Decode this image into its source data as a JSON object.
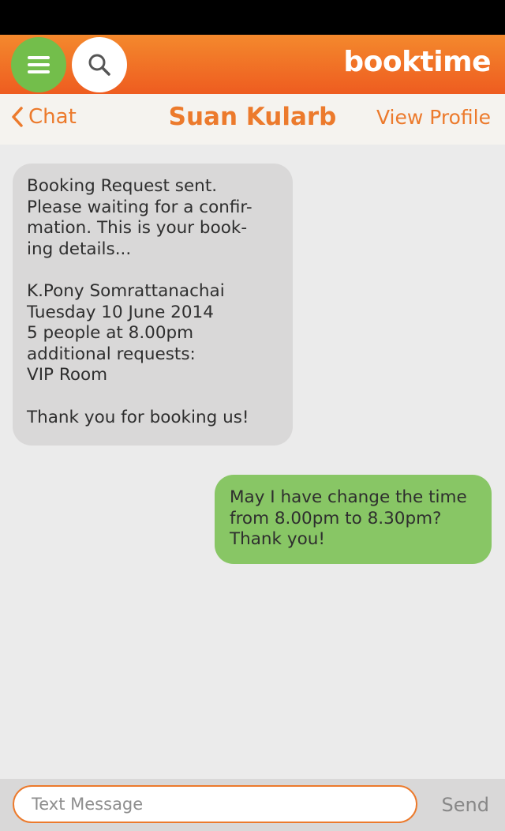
{
  "header": {
    "logo_text": "booktime",
    "menu_icon": "hamburger-menu-icon",
    "search_icon": "search-icon",
    "colors": {
      "bar_top": "#f4892d",
      "bar_bottom": "#ee5c20",
      "menu_button": "#73be4b",
      "accent": "#ec7a2c"
    }
  },
  "nav": {
    "back_label": "Chat",
    "contact_name": "Suan Kularb",
    "view_profile_label": "View Profile"
  },
  "messages": [
    {
      "direction": "received",
      "text": "Booking Request sent.\nPlease waiting for a confir-\nmation. This is your book-\ning details...\n\nK.Pony Somrattanachai\nTuesday 10 June 2014\n5 people at 8.00pm\nadditional requests:\nVIP Room\n\nThank you for booking us!",
      "color": "#d9d8d8"
    },
    {
      "direction": "sent",
      "text": "May I have change the time\nfrom 8.00pm to 8.30pm?\nThank you!",
      "color": "#88c665"
    }
  ],
  "composer": {
    "placeholder": "Text Message",
    "value": "",
    "send_label": "Send"
  }
}
